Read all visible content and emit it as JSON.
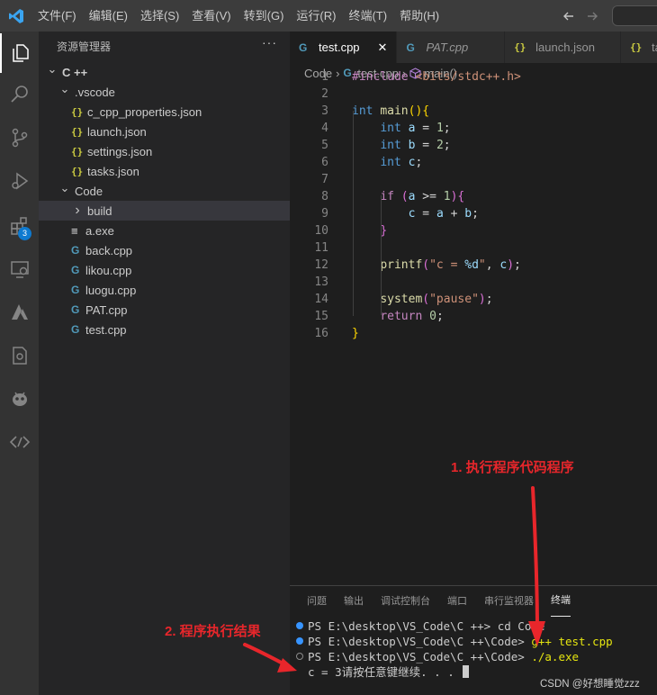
{
  "menu": [
    "文件(F)",
    "编辑(E)",
    "选择(S)",
    "查看(V)",
    "转到(G)",
    "运行(R)",
    "终端(T)",
    "帮助(H)"
  ],
  "activity_bar": {
    "extensions_badge": "3"
  },
  "explorer": {
    "title": "资源管理器",
    "more": "···",
    "tree": [
      {
        "label": "C ++",
        "type": "folder",
        "open": true,
        "indent": 0
      },
      {
        "label": ".vscode",
        "type": "folder",
        "open": true,
        "indent": 1
      },
      {
        "label": "c_cpp_properties.json",
        "type": "json",
        "indent": 2
      },
      {
        "label": "launch.json",
        "type": "json",
        "indent": 2
      },
      {
        "label": "settings.json",
        "type": "json",
        "indent": 2
      },
      {
        "label": "tasks.json",
        "type": "json",
        "indent": 2
      },
      {
        "label": "Code",
        "type": "folder",
        "open": true,
        "indent": 1
      },
      {
        "label": "build",
        "type": "folder",
        "open": false,
        "indent": 2,
        "selected": true
      },
      {
        "label": "a.exe",
        "type": "exe",
        "indent": 2
      },
      {
        "label": "back.cpp",
        "type": "cpp",
        "indent": 2
      },
      {
        "label": "likou.cpp",
        "type": "cpp",
        "indent": 2
      },
      {
        "label": "luogu.cpp",
        "type": "cpp",
        "indent": 2
      },
      {
        "label": "PAT.cpp",
        "type": "cpp",
        "indent": 2
      },
      {
        "label": "test.cpp",
        "type": "cpp",
        "indent": 2
      }
    ]
  },
  "tabs": [
    {
      "label": "test.cpp",
      "type": "cpp",
      "active": true,
      "close": "✕"
    },
    {
      "label": "PAT.cpp",
      "type": "cpp",
      "active": false,
      "italic": true
    },
    {
      "label": "launch.json",
      "type": "json",
      "active": false
    },
    {
      "label": "ta",
      "type": "json",
      "active": false
    }
  ],
  "breadcrumb": [
    "Code",
    "test.cpp",
    "main()"
  ],
  "code_lines": [
    {
      "n": "1",
      "html": "<span class='pp'>#include</span> <span class='str'>&lt;bits/stdc++.h&gt;</span>"
    },
    {
      "n": "2",
      "html": ""
    },
    {
      "n": "3",
      "html": "<span class='kw'>int</span> <span class='fn'>main</span><span class='br1'>()</span><span class='br1'>{</span>"
    },
    {
      "n": "4",
      "html": "    <span class='kw'>int</span> <span class='var'>a</span> = <span class='num'>1</span>;"
    },
    {
      "n": "5",
      "html": "    <span class='kw'>int</span> <span class='var'>b</span> = <span class='num'>2</span>;"
    },
    {
      "n": "6",
      "html": "    <span class='kw'>int</span> <span class='var'>c</span>;"
    },
    {
      "n": "7",
      "html": ""
    },
    {
      "n": "8",
      "html": "    <span class='pp'>if</span> <span class='br2'>(</span><span class='var'>a</span> &gt;= <span class='num'>1</span><span class='br2'>)</span><span class='br2'>{</span>"
    },
    {
      "n": "9",
      "html": "        <span class='var'>c</span> = <span class='var'>a</span> + <span class='var'>b</span>;"
    },
    {
      "n": "10",
      "html": "    <span class='br2'>}</span>"
    },
    {
      "n": "11",
      "html": ""
    },
    {
      "n": "12",
      "html": "    <span class='fn'>printf</span><span class='br2'>(</span><span class='str'>\"c = </span><span class='ph'>%d</span><span class='str'>\"</span>, <span class='var'>c</span><span class='br2'>)</span>;"
    },
    {
      "n": "13",
      "html": ""
    },
    {
      "n": "14",
      "html": "    <span class='fn'>system</span><span class='br2'>(</span><span class='str'>\"pause\"</span><span class='br2'>)</span>;"
    },
    {
      "n": "15",
      "html": "    <span class='pp'>return</span> <span class='num'>0</span>;"
    },
    {
      "n": "16",
      "html": "<span class='br1'>}</span>"
    }
  ],
  "panel_tabs": [
    {
      "label": "问题",
      "active": false
    },
    {
      "label": "输出",
      "active": false
    },
    {
      "label": "调试控制台",
      "active": false
    },
    {
      "label": "端口",
      "active": false
    },
    {
      "label": "串行监视器",
      "active": false
    },
    {
      "label": "终端",
      "active": true
    }
  ],
  "terminal": [
    {
      "dot": "blue",
      "prompt": "PS E:\\desktop\\VS_Code\\C ++> ",
      "cmd": "cd Code",
      "cmd_color": "plain"
    },
    {
      "dot": "blue",
      "prompt": "PS E:\\desktop\\VS_Code\\C ++\\Code> ",
      "cmd": "g++ test.cpp",
      "cmd_color": "yellow"
    },
    {
      "dot": "hollow",
      "prompt": "PS E:\\desktop\\VS_Code\\C ++\\Code> ",
      "cmd": "./a.exe",
      "cmd_color": "yellow"
    },
    {
      "dot": "none",
      "prompt": "c = 3请按任意键继续. . . ",
      "cmd": "",
      "cursor": true
    }
  ],
  "annotations": {
    "step1": "1. 执行程序代码程序",
    "step2": "2. 程序执行结果",
    "color": "#e8262b"
  },
  "watermark": "CSDN @好想睡觉zzz"
}
